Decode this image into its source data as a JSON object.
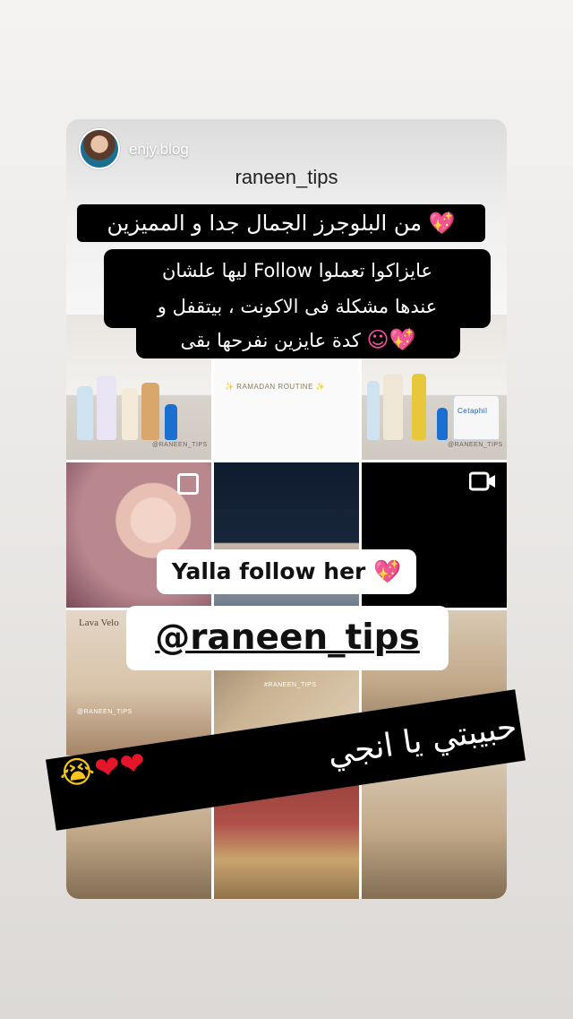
{
  "story": {
    "mention_user": "enjy.blog",
    "profile_username": "raneen_tips"
  },
  "grid_labels": {
    "left_caption": "@RANEEN_TIPS",
    "ramadan": "✨ RAMADAN ROUTINE ✨",
    "right_caption": "@RANEEN_TIPS",
    "brand_box": "Lava Velo",
    "left_box_caption": "@RANEEN_TIPS",
    "mid_box_caption": "#RANEEN_TIPS",
    "cetaphil": "Cetaphil"
  },
  "stickers": {
    "line1": "من البلوجرز الجمال جدا و المميزين",
    "line1_emoji": "💖",
    "line2a": "عايزاكوا تعملوا Follow ليها علشان",
    "line2b": "عندها مشكلة فى الاكونت ، بيتقفل و",
    "line3": "كدة عايزين نفرحها بقى",
    "line3_emoji": "💖☺",
    "yalla": "Yalla follow her 💖",
    "mention": "@raneen_tips",
    "arabic_bottom": "حبيبتي يا انجي",
    "hearts": "❤❤",
    "cry_emoji": "😭"
  },
  "colors": {
    "sticker_black": "#000000",
    "accent_pink": "#ff4fa3",
    "heart_red": "#e6162a"
  }
}
